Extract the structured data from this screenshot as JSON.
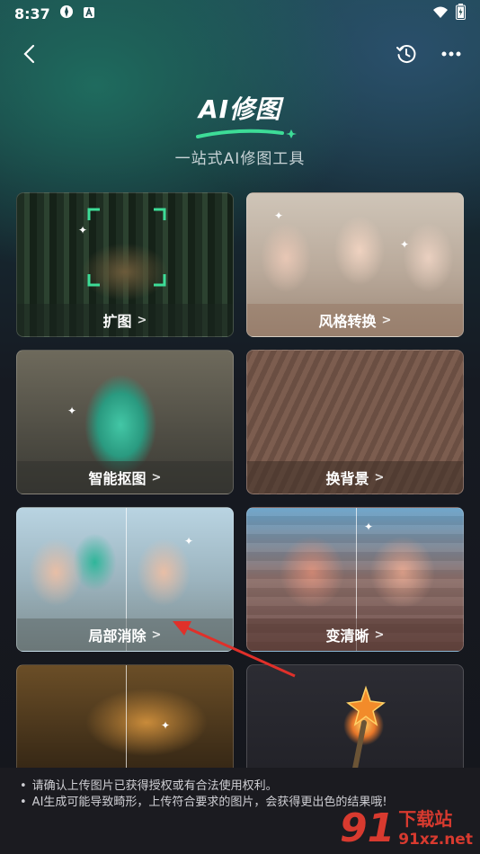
{
  "status_bar": {
    "time": "8:37"
  },
  "header": {
    "title": "AI修图",
    "subtitle": "一站式AI修图工具"
  },
  "tools": [
    {
      "label": "扩图",
      "bg": "forest"
    },
    {
      "label": "风格转换",
      "bg": "style"
    },
    {
      "label": "智能抠图",
      "bg": "rabbit"
    },
    {
      "label": "换背景",
      "bg": "street"
    },
    {
      "label": "局部消除",
      "bg": "selfie"
    },
    {
      "label": "变清晰",
      "bg": "clear"
    },
    {
      "label": "",
      "bg": "house"
    },
    {
      "label": "",
      "bg": "wand"
    }
  ],
  "chevron": ">",
  "notes": [
    "请确认上传图片已获得授权或有合法使用权利。",
    "AI生成可能导致畸形，上传符合要求的图片，会获得更出色的结果哦!"
  ],
  "watermark": {
    "number": "91",
    "cn": "下载站",
    "url": "91xz.net"
  },
  "colors": {
    "accent_green": "#3ddc97",
    "watermark_red": "#d83a2f",
    "annotation_red": "#e0302a"
  }
}
